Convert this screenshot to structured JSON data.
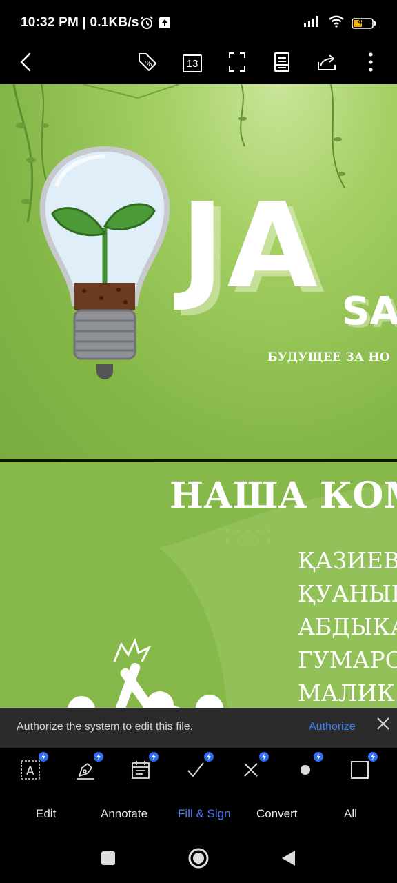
{
  "status_bar": {
    "time": "10:32 PM",
    "separator": "|",
    "speed": "0.1KB/s",
    "battery": "41",
    "icons": [
      "alarm-icon",
      "upload-icon",
      "signal-icon",
      "wifi-icon",
      "battery-icon"
    ]
  },
  "toolbar": {
    "page_count": "13",
    "icons": [
      "back-icon",
      "tag-icon",
      "page-count-icon",
      "fullscreen-icon",
      "reading-mode-icon",
      "share-icon",
      "more-icon"
    ]
  },
  "document": {
    "page1": {
      "title": "JA",
      "subtitle": "SA",
      "tagline": "БУДУЩЕЕ ЗА НО"
    },
    "page2": {
      "title": "НАША КОМ",
      "members": [
        "ҚАЗИЕВА",
        "ҚУАНЫШ",
        "АБДЫКА",
        "ГУМАРО",
        "МАЛИК А"
      ]
    }
  },
  "banner": {
    "message": "Authorize the system to edit this file.",
    "action": "Authorize"
  },
  "tools": [
    "text-box-icon",
    "signature-icon",
    "date-icon",
    "checkmark-icon",
    "cross-icon",
    "dot-icon",
    "rectangle-icon"
  ],
  "tabs": [
    {
      "label": "Edit",
      "active": false
    },
    {
      "label": "Annotate",
      "active": false
    },
    {
      "label": "Fill & Sign",
      "active": true
    },
    {
      "label": "Convert",
      "active": false
    },
    {
      "label": "All",
      "active": false
    }
  ],
  "colors": {
    "accent": "#4b7bf2",
    "badge": "#2f6cf0",
    "page_green": "#86b84a",
    "banner_bg": "#2b2b2b"
  }
}
